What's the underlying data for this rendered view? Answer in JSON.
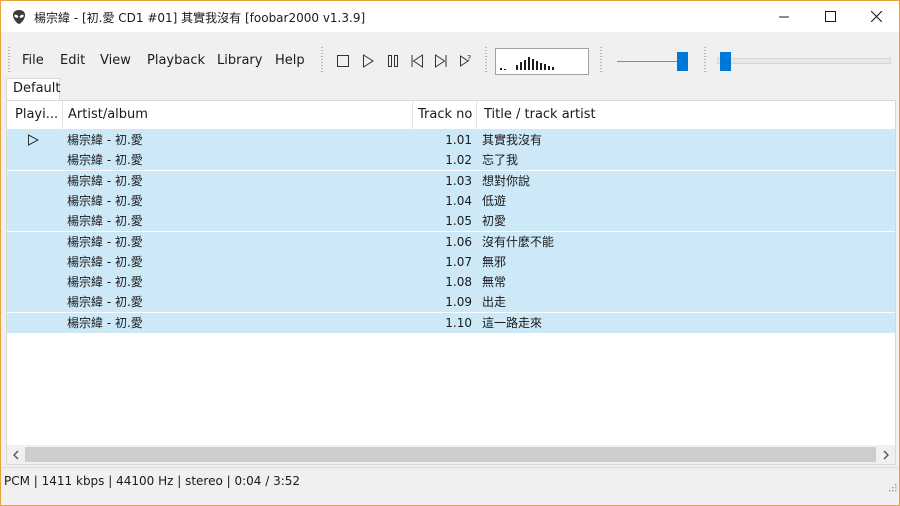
{
  "window": {
    "title": "楊宗緯 - [初.愛 CD1 #01] 其實我沒有  [foobar2000 v1.3.9]",
    "app_icon": "alien-icon",
    "controls": [
      "minimize-icon",
      "maximize-icon",
      "close-icon"
    ]
  },
  "menu": {
    "file": "File",
    "edit": "Edit",
    "view": "View",
    "playback": "Playback",
    "library": "Library",
    "help": "Help"
  },
  "toolbar": {
    "buttons": [
      "stop-icon",
      "play-icon",
      "pause-icon",
      "previous-icon",
      "next-icon",
      "random-icon"
    ],
    "visualizer_bar_heights": [
      0.15,
      0.1,
      0.35,
      0.55,
      0.7,
      0.9,
      0.8,
      0.65,
      0.5,
      0.4,
      0.3,
      0.2
    ],
    "volume_level": 0.95,
    "seek_position": 0.017
  },
  "tabs": [
    {
      "label": "Default",
      "active": true
    }
  ],
  "playlist": {
    "columns": {
      "playing": "Playi...",
      "artist_album": "Artist/album",
      "track_no": "Track no",
      "title": "Title / track artist"
    },
    "rows": [
      {
        "playing": true,
        "artist_album": "楊宗緯 - 初.愛",
        "track_no": "1.01",
        "title": "其實我沒有"
      },
      {
        "playing": false,
        "artist_album": "楊宗緯 - 初.愛",
        "track_no": "1.02",
        "title": "忘了我"
      },
      {
        "playing": false,
        "artist_album": "楊宗緯 - 初.愛",
        "track_no": "1.03",
        "title": "想對你說"
      },
      {
        "playing": false,
        "artist_album": "楊宗緯 - 初.愛",
        "track_no": "1.04",
        "title": "低遊"
      },
      {
        "playing": false,
        "artist_album": "楊宗緯 - 初.愛",
        "track_no": "1.05",
        "title": "初愛"
      },
      {
        "playing": false,
        "artist_album": "楊宗緯 - 初.愛",
        "track_no": "1.06",
        "title": "沒有什麼不能"
      },
      {
        "playing": false,
        "artist_album": "楊宗緯 - 初.愛",
        "track_no": "1.07",
        "title": "無邪"
      },
      {
        "playing": false,
        "artist_album": "楊宗緯 - 初.愛",
        "track_no": "1.08",
        "title": "無常"
      },
      {
        "playing": false,
        "artist_album": "楊宗緯 - 初.愛",
        "track_no": "1.09",
        "title": "出走"
      },
      {
        "playing": false,
        "artist_album": "楊宗緯 - 初.愛",
        "track_no": "1.10",
        "title": "這一路走來"
      }
    ],
    "selection_color": "#cde8f7"
  },
  "statusbar": {
    "text": "PCM | 1411 kbps | 44100 Hz | stereo | 0:04 / 3:52"
  },
  "colors": {
    "accent": "#0078d7",
    "window_border": "#e8a33a"
  }
}
